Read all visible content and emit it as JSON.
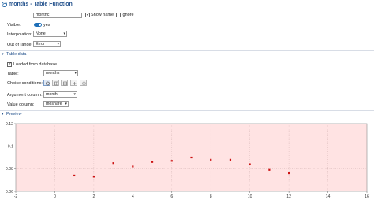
{
  "window": {
    "title": "months - Table Function"
  },
  "form": {
    "name_value": "monthc",
    "show_name_label": "Show name",
    "show_name_checked": true,
    "ignore_label": "Ignore",
    "ignore_checked": false,
    "visible_label": "Visible:",
    "visible_value": "yes",
    "interpolation_label": "Interpolation:",
    "interpolation_value": "None",
    "out_of_range_label": "Out of range:",
    "out_of_range_value": "Error"
  },
  "table_data": {
    "section_label": "Table data",
    "loaded_label": "Loaded from database",
    "loaded_checked": true,
    "table_label": "Table:",
    "table_value": "months",
    "choice_label": "Choice conditions:",
    "argument_label": "Argument column:",
    "argument_value": "month",
    "value_label": "Value column:",
    "value_value": "moshare"
  },
  "preview": {
    "section_label": "Preview"
  },
  "chart_data": {
    "type": "scatter",
    "title": "",
    "xlabel": "",
    "ylabel": "",
    "xlim": [
      -2,
      16
    ],
    "ylim": [
      0.06,
      0.12
    ],
    "xticks": [
      "-2",
      "0",
      "2",
      "4",
      "6",
      "8",
      "10",
      "12",
      "14",
      "16"
    ],
    "yticks": [
      "0.12",
      "0.1",
      "0.08",
      "0.06"
    ],
    "grid": true,
    "background_color": "#ffe3e3",
    "marker_color": "#cc1111",
    "x": [
      1,
      2,
      3,
      4,
      5,
      6,
      7,
      8,
      9,
      10,
      11,
      12
    ],
    "y": [
      0.074,
      0.073,
      0.085,
      0.082,
      0.086,
      0.087,
      0.09,
      0.088,
      0.088,
      0.084,
      0.079,
      0.076
    ]
  },
  "colors": {
    "accent": "#1f4e8a",
    "toggle": "#1e6fb8"
  }
}
